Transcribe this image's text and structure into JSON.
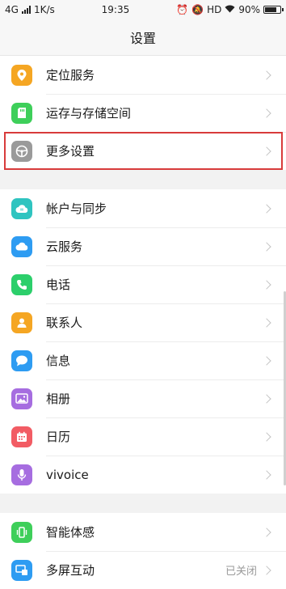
{
  "status": {
    "network": "4G",
    "speed": "1K/s",
    "time": "19:35",
    "hd": "HD",
    "battery": "90%",
    "battery_level": 0.9
  },
  "header": {
    "title": "设置"
  },
  "groups": [
    {
      "items": [
        {
          "label": "定位服务",
          "icon": "location-pin-icon",
          "color": "#f5a623"
        },
        {
          "label": "运存与存储空间",
          "icon": "sd-card-icon",
          "color": "#3ecf5a"
        },
        {
          "label": "更多设置",
          "icon": "steering-wheel-icon",
          "color": "#9a9a9a"
        }
      ]
    },
    {
      "items": [
        {
          "label": "帐户与同步",
          "icon": "cloud-account-icon",
          "color": "#2fc4c0"
        },
        {
          "label": "云服务",
          "icon": "cloud-icon",
          "color": "#2e9cf2"
        },
        {
          "label": "电话",
          "icon": "phone-icon",
          "color": "#2ccf6b"
        },
        {
          "label": "联系人",
          "icon": "contact-icon",
          "color": "#f5a623"
        },
        {
          "label": "信息",
          "icon": "message-icon",
          "color": "#2e9cf2"
        },
        {
          "label": "相册",
          "icon": "album-icon",
          "color": "#a66de0"
        },
        {
          "label": "日历",
          "icon": "calendar-icon",
          "color": "#f25c64"
        },
        {
          "label": "vivoice",
          "icon": "microphone-icon",
          "color": "#a66de0"
        }
      ]
    },
    {
      "items": [
        {
          "label": "智能体感",
          "icon": "motion-phone-icon",
          "color": "#3ecf5a"
        },
        {
          "label": "多屏互动",
          "icon": "multi-screen-icon",
          "color": "#2e9cf2",
          "value": "已关闭"
        }
      ]
    }
  ],
  "highlight_target": "更多设置"
}
